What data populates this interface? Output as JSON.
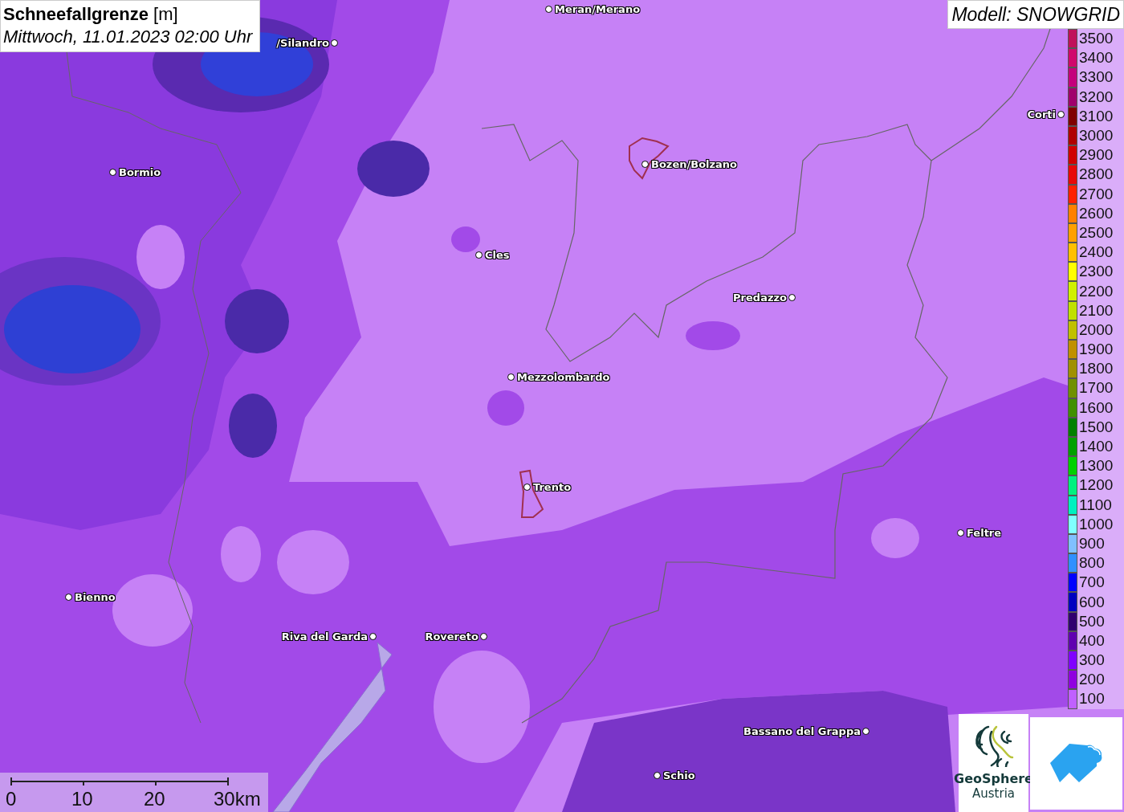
{
  "title": {
    "heading": "Schneefallgrenze",
    "unit": "[m]",
    "datetime": "Mittwoch, 11.01.2023 02:00 Uhr"
  },
  "model": "Modell: SNOWGRID",
  "cities": [
    {
      "name": "Meran/Merano"
    },
    {
      "name": "/Silandro"
    },
    {
      "name": "Bormio"
    },
    {
      "name": "Bozen/Bolzano"
    },
    {
      "name": "Cles"
    },
    {
      "name": "Predazzo"
    },
    {
      "name": "Mezzolombardo"
    },
    {
      "name": "Trento"
    },
    {
      "name": "Feltre"
    },
    {
      "name": "Bienno"
    },
    {
      "name": "Riva del Garda"
    },
    {
      "name": "Rovereto"
    },
    {
      "name": "Bassano del Grappa"
    },
    {
      "name": "Schio"
    },
    {
      "name": "Corti"
    }
  ],
  "legend": [
    {
      "label": "3500",
      "color": "#c0105a"
    },
    {
      "label": "3400",
      "color": "#d0086c"
    },
    {
      "label": "3300",
      "color": "#c4007c"
    },
    {
      "label": "3200",
      "color": "#a0006c"
    },
    {
      "label": "3100",
      "color": "#800000"
    },
    {
      "label": "3000",
      "color": "#b00000"
    },
    {
      "label": "2900",
      "color": "#d00000"
    },
    {
      "label": "2800",
      "color": "#e80808"
    },
    {
      "label": "2700",
      "color": "#ff2000"
    },
    {
      "label": "2600",
      "color": "#ff8000"
    },
    {
      "label": "2500",
      "color": "#ffa000"
    },
    {
      "label": "2400",
      "color": "#ffc000"
    },
    {
      "label": "2300",
      "color": "#ffff00"
    },
    {
      "label": "2200",
      "color": "#d0f000"
    },
    {
      "label": "2100",
      "color": "#c0e000"
    },
    {
      "label": "2000",
      "color": "#c0c000"
    },
    {
      "label": "1900",
      "color": "#c09000"
    },
    {
      "label": "1800",
      "color": "#a09000"
    },
    {
      "label": "1700",
      "color": "#709000"
    },
    {
      "label": "1600",
      "color": "#409000"
    },
    {
      "label": "1500",
      "color": "#008000"
    },
    {
      "label": "1400",
      "color": "#00a000"
    },
    {
      "label": "1300",
      "color": "#00d000"
    },
    {
      "label": "1200",
      "color": "#00f080"
    },
    {
      "label": "1100",
      "color": "#00f0c0"
    },
    {
      "label": "1000",
      "color": "#80ffff"
    },
    {
      "label": "900",
      "color": "#80c0ff"
    },
    {
      "label": "800",
      "color": "#3090ff"
    },
    {
      "label": "700",
      "color": "#0000ff"
    },
    {
      "label": "600",
      "color": "#0000c0"
    },
    {
      "label": "500",
      "color": "#300070"
    },
    {
      "label": "400",
      "color": "#6000b0"
    },
    {
      "label": "300",
      "color": "#8000ff"
    },
    {
      "label": "200",
      "color": "#9000e0"
    },
    {
      "label": "100",
      "color": "#c060ff"
    }
  ],
  "scale": [
    "0",
    "10",
    "20",
    "30km"
  ],
  "logo": {
    "name": "GeoSphere",
    "subtitle": "Austria"
  }
}
